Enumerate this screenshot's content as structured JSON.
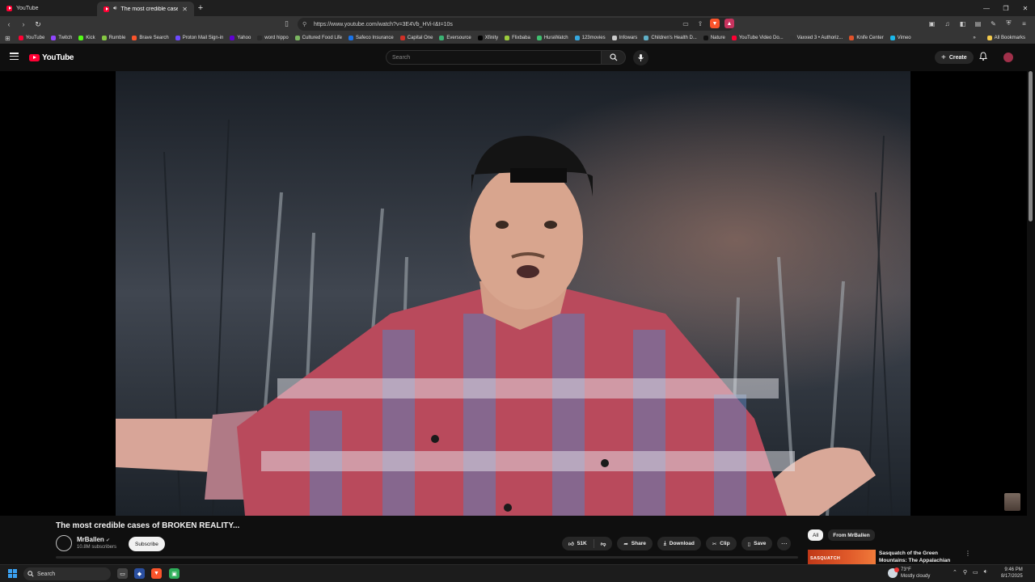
{
  "browser": {
    "tabs": [
      {
        "label": "YouTube",
        "active": false
      },
      {
        "label": "The most credible cases of BR",
        "active": true
      }
    ],
    "url": "https://www.youtube.com/watch?v=3E4Vb_HVi-I&t=10s",
    "bookmarks": [
      {
        "label": "YouTube",
        "color": "#ff0033"
      },
      {
        "label": "Twitch",
        "color": "#9146ff"
      },
      {
        "label": "Kick",
        "color": "#53fc18"
      },
      {
        "label": "Rumble",
        "color": "#85c742"
      },
      {
        "label": "Brave Search",
        "color": "#fb542b"
      },
      {
        "label": "Proton Mail Sign-in",
        "color": "#6d4aff"
      },
      {
        "label": "Yahoo",
        "color": "#6001d2"
      },
      {
        "label": "word hippo",
        "color": "#2a2a2a"
      },
      {
        "label": "Cultured Food Life",
        "color": "#7bb661"
      },
      {
        "label": "Safeco Insurance",
        "color": "#1a73e8"
      },
      {
        "label": "Capital One",
        "color": "#d03027"
      },
      {
        "label": "Eversource",
        "color": "#3bb273"
      },
      {
        "label": "Xfinity",
        "color": "#000000"
      },
      {
        "label": "Flixbaba",
        "color": "#9ccc3c"
      },
      {
        "label": "HuraWatch",
        "color": "#3fbf6f"
      },
      {
        "label": "123movies",
        "color": "#35a8e0"
      },
      {
        "label": "Infowars",
        "color": "#cccccc"
      },
      {
        "label": "Children's Health D...",
        "color": "#5fb0c7"
      },
      {
        "label": "Nature",
        "color": "#111111"
      },
      {
        "label": "YouTube Video Do...",
        "color": "#ff0033"
      },
      {
        "label": "Vaxxed 3 • Authoriz...",
        "color": "#333333"
      },
      {
        "label": "Knife Center",
        "color": "#e0522a"
      },
      {
        "label": "Vimeo",
        "color": "#1ab7ea"
      }
    ],
    "all_bookmarks": "All Bookmarks"
  },
  "youtube": {
    "logo_text": "YouTube",
    "search_placeholder": "Search",
    "create_label": "Create"
  },
  "video": {
    "title": "The most credible cases of BROKEN REALITY...",
    "channel_name": "MrBallen",
    "channel_subs": "10.8M subscribers",
    "subscribe_label": "Subscribe",
    "likes": "51K",
    "share_label": "Share",
    "download_label": "Download",
    "clip_label": "Clip",
    "save_label": "Save"
  },
  "sidebar": {
    "chips": [
      "All",
      "From MrBallen"
    ],
    "recommendation": {
      "title": "Sasquatch of the Green Mountains: The Appalachian",
      "thumb_text": "SASQUATCH"
    }
  },
  "taskbar": {
    "search_label": "Search",
    "weather_temp": "73°F",
    "weather_desc": "Mostly cloudy",
    "time": "9:46 PM",
    "date": "8/17/2025"
  }
}
